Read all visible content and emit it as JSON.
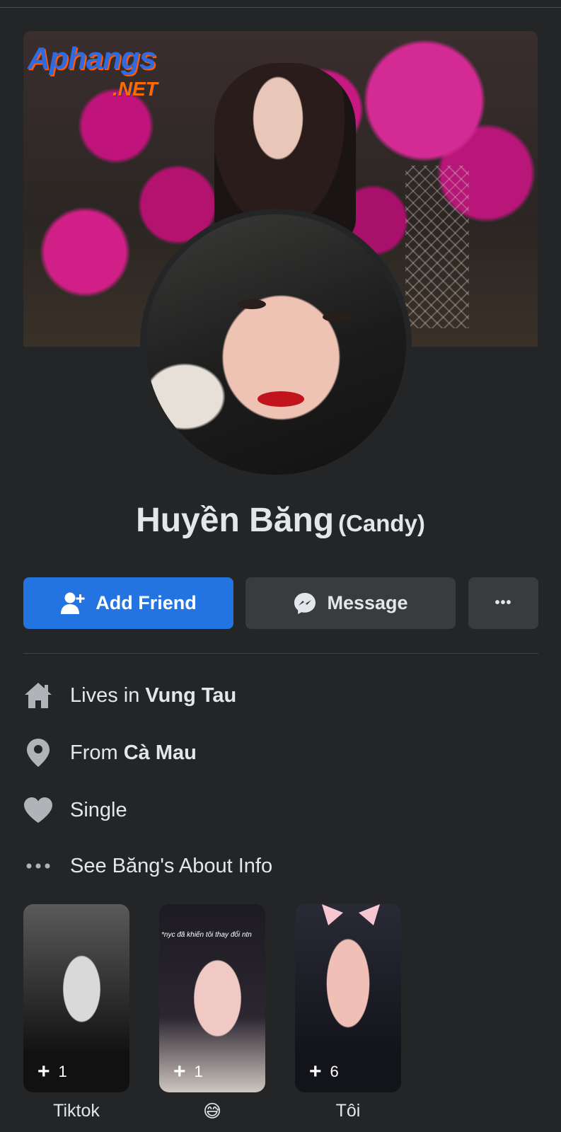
{
  "cover": {
    "watermark": {
      "brand": "Aphangs",
      "domain": ".NET"
    }
  },
  "profile": {
    "name": "Huyền Băng",
    "alternate_name": "(Candy)"
  },
  "actions": {
    "add_friend": "Add Friend",
    "message": "Message",
    "more": "•••"
  },
  "intro": {
    "lives_prefix": "Lives in ",
    "lives_value": "Vung Tau",
    "from_prefix": "From ",
    "from_value": "Cà Mau",
    "relationship": "Single",
    "about_link": "See Băng's About Info"
  },
  "highlights": [
    {
      "label": "Tiktok",
      "count": "1"
    },
    {
      "label": "😅",
      "count": "1",
      "caption": "*nyc đã khiến tôi thay đổi ntn"
    },
    {
      "label": "Tôi",
      "count": "6"
    }
  ],
  "colors": {
    "background": "#242526",
    "primary": "#2374e1",
    "secondary_button": "#3a3b3c",
    "icon": "#b0b3b8"
  },
  "icons": [
    "add-friend-icon",
    "messenger-icon",
    "more-icon",
    "home-icon",
    "location-pin-icon",
    "heart-icon",
    "dots-icon",
    "plus-icon"
  ]
}
